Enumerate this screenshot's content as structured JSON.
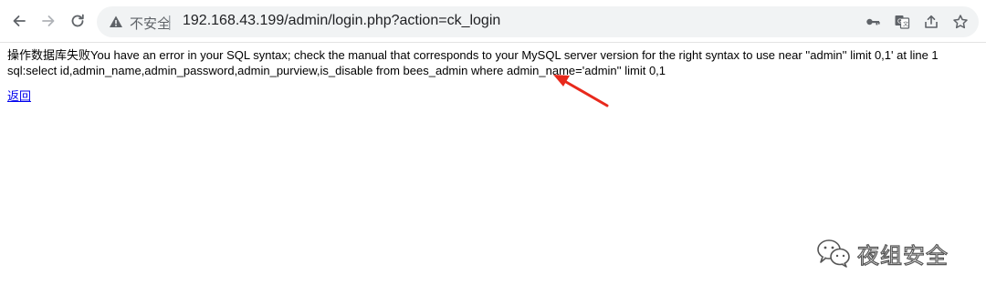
{
  "browser": {
    "security_label": "不安全",
    "separator": "|",
    "url": "192.168.43.199/admin/login.php?action=ck_login",
    "icons": [
      "back-icon",
      "forward-icon",
      "reload-icon",
      "warning-icon",
      "key-icon",
      "translate-icon",
      "share-icon",
      "star-icon"
    ]
  },
  "page": {
    "error_line1": "操作数据库失败You have an error in your SQL syntax; check the manual that corresponds to your MySQL server version for the right syntax to use near ''admin'' limit 0,1' at line 1",
    "error_line2": "sql:select id,admin_name,admin_password,admin_purview,is_disable from bees_admin where admin_name='admin'' limit 0,1",
    "back_link": "返回"
  },
  "annotation": {
    "arrow_color": "#e8291c"
  },
  "watermark": {
    "text": "夜组安全",
    "icon": "wechat-icon"
  }
}
